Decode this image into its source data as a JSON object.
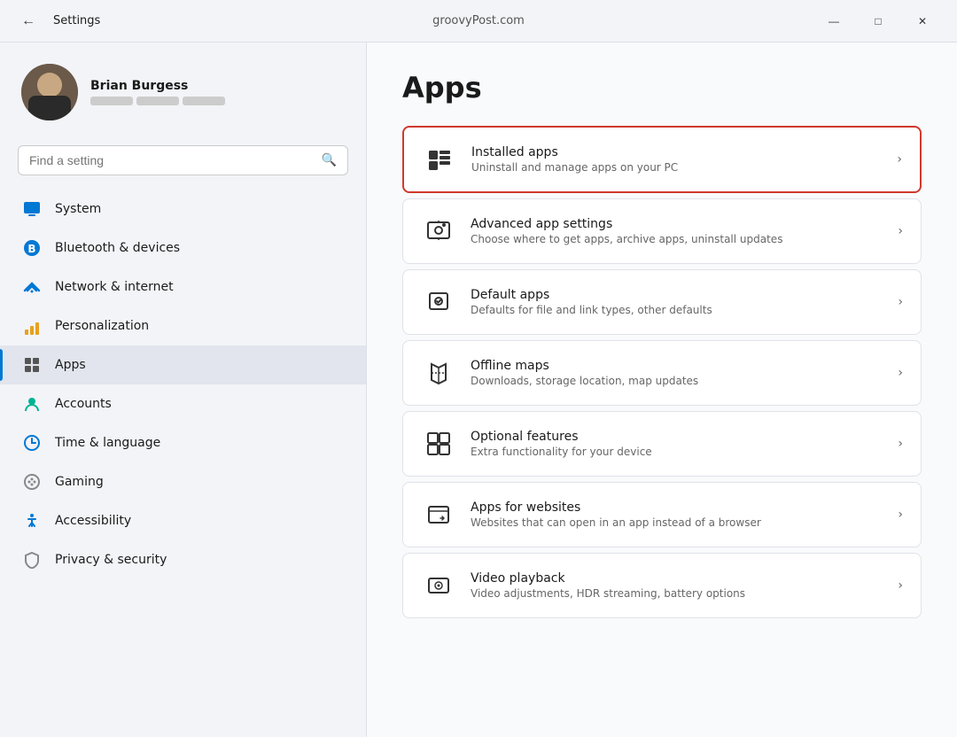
{
  "titleBar": {
    "backLabel": "←",
    "title": "Settings",
    "centerText": "groovyPost.com",
    "minimizeLabel": "—",
    "maximizeLabel": "□",
    "closeLabel": "✕"
  },
  "sidebar": {
    "userName": "Brian Burgess",
    "searchPlaceholder": "Find a setting",
    "navItems": [
      {
        "id": "system",
        "label": "System",
        "iconType": "system"
      },
      {
        "id": "bluetooth",
        "label": "Bluetooth & devices",
        "iconType": "bluetooth"
      },
      {
        "id": "network",
        "label": "Network & internet",
        "iconType": "network"
      },
      {
        "id": "personalization",
        "label": "Personalization",
        "iconType": "personalization"
      },
      {
        "id": "apps",
        "label": "Apps",
        "iconType": "apps",
        "active": true
      },
      {
        "id": "accounts",
        "label": "Accounts",
        "iconType": "accounts"
      },
      {
        "id": "time",
        "label": "Time & language",
        "iconType": "time"
      },
      {
        "id": "gaming",
        "label": "Gaming",
        "iconType": "gaming"
      },
      {
        "id": "accessibility",
        "label": "Accessibility",
        "iconType": "accessibility"
      },
      {
        "id": "privacy",
        "label": "Privacy & security",
        "iconType": "privacy"
      }
    ]
  },
  "content": {
    "pageTitle": "Apps",
    "settingsItems": [
      {
        "id": "installed-apps",
        "title": "Installed apps",
        "description": "Uninstall and manage apps on your PC",
        "highlighted": true
      },
      {
        "id": "advanced-app-settings",
        "title": "Advanced app settings",
        "description": "Choose where to get apps, archive apps, uninstall updates",
        "highlighted": false
      },
      {
        "id": "default-apps",
        "title": "Default apps",
        "description": "Defaults for file and link types, other defaults",
        "highlighted": false
      },
      {
        "id": "offline-maps",
        "title": "Offline maps",
        "description": "Downloads, storage location, map updates",
        "highlighted": false
      },
      {
        "id": "optional-features",
        "title": "Optional features",
        "description": "Extra functionality for your device",
        "highlighted": false
      },
      {
        "id": "apps-for-websites",
        "title": "Apps for websites",
        "description": "Websites that can open in an app instead of a browser",
        "highlighted": false
      },
      {
        "id": "video-playback",
        "title": "Video playback",
        "description": "Video adjustments, HDR streaming, battery options",
        "highlighted": false
      }
    ]
  }
}
